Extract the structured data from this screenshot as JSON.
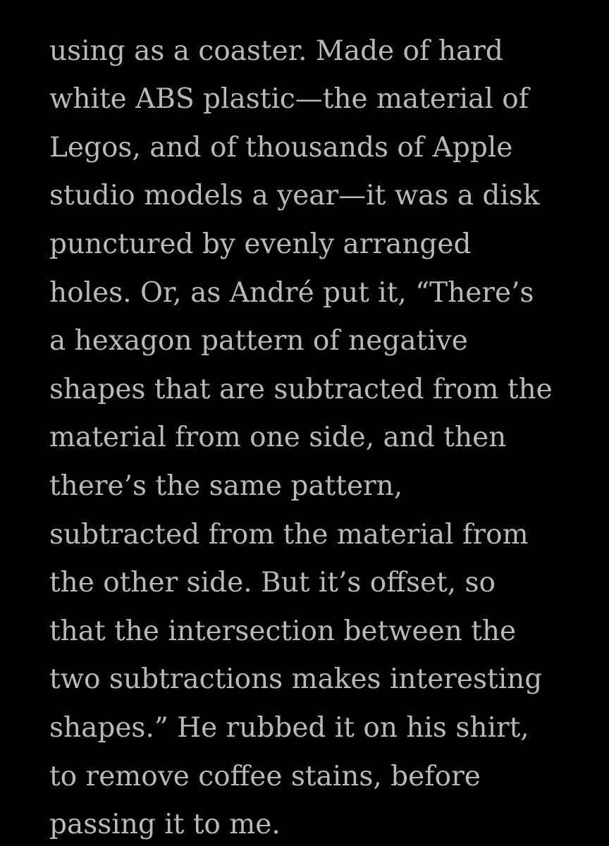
{
  "reader": {
    "background_color": "#000000",
    "text_color": "#b9b9b9",
    "lines": [
      "",
      "using as a coaster. Made of hard",
      "white ABS plastic—the material of",
      "Legos, and of thousands of Apple",
      "studio models a year—it was a disk",
      "punctured by evenly arranged",
      "holes. Or, as André put it, “There’s",
      "a hexagon pattern of negative",
      "shapes that are subtracted from the",
      "material from one side, and then",
      "there’s the same pattern,",
      "subtracted from the material from",
      "the other side. But it’s offset, so",
      "that the intersection between the",
      "two subtractions makes interesting",
      "shapes.” He rubbed it on his shirt,",
      "to remove coffee stains, before",
      "passing it to me."
    ]
  }
}
